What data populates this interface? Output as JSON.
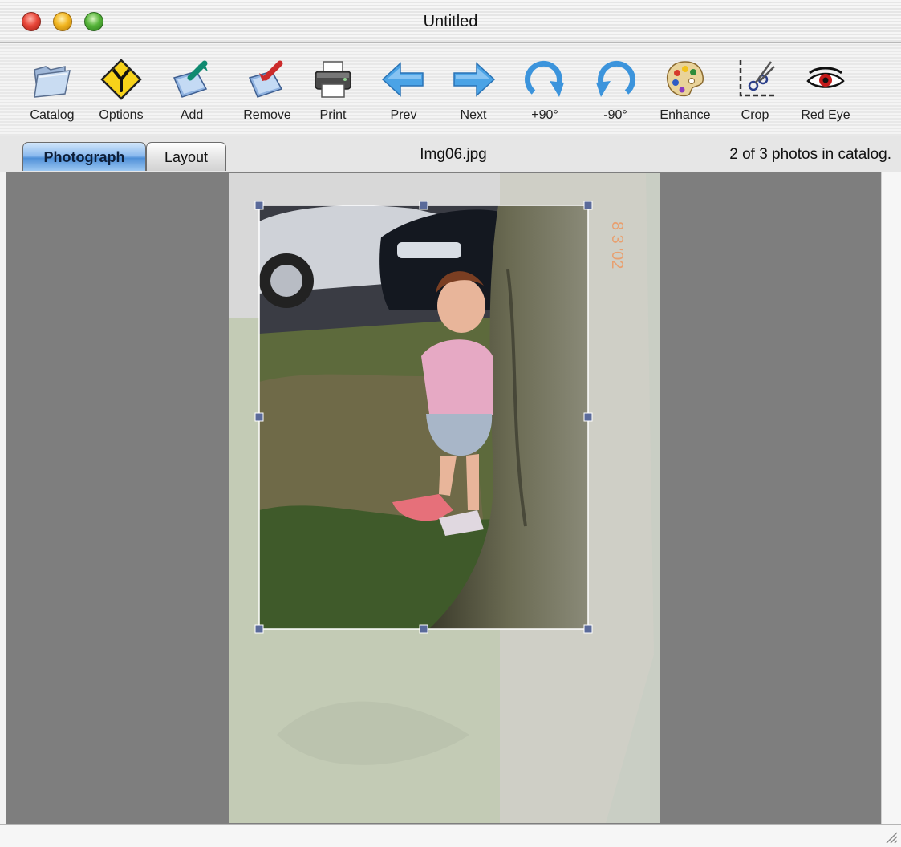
{
  "window": {
    "title": "Untitled",
    "controls": [
      "close-button",
      "minimize-button",
      "zoom-button"
    ]
  },
  "toolbar": {
    "items": [
      {
        "label": "Catalog",
        "icon": "folder-icon"
      },
      {
        "label": "Options",
        "icon": "road-sign-icon"
      },
      {
        "label": "Add",
        "icon": "add-photo-icon"
      },
      {
        "label": "Remove",
        "icon": "remove-photo-icon"
      },
      {
        "label": "Print",
        "icon": "printer-icon"
      },
      {
        "label": "Prev",
        "icon": "arrow-left-icon"
      },
      {
        "label": "Next",
        "icon": "arrow-right-icon"
      },
      {
        "label": "+90°",
        "icon": "rotate-clockwise-icon"
      },
      {
        "label": "-90°",
        "icon": "rotate-counterclockwise-icon"
      },
      {
        "label": "Enhance",
        "icon": "palette-icon"
      },
      {
        "label": "Crop",
        "icon": "crop-scissors-icon"
      },
      {
        "label": "Red Eye",
        "icon": "red-eye-icon"
      }
    ]
  },
  "tabs": [
    {
      "label": "Photograph",
      "active": true
    },
    {
      "label": "Layout",
      "active": false
    }
  ],
  "photo": {
    "filename": "Img06.jpg",
    "catalog_status": "2 of 3 photos in catalog.",
    "date_stamp": "8 3 '02"
  },
  "colors": {
    "content_background": "#7e7e7e",
    "active_tab": "#4f90d8",
    "crop_handle": "#5a6a9a"
  }
}
